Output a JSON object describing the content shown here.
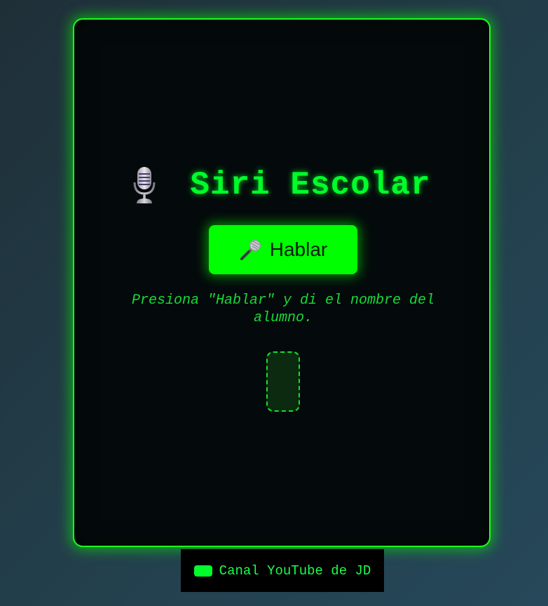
{
  "app": {
    "title": "Siri Escolar"
  },
  "main": {
    "speak_button_label": "Hablar",
    "instructions": "Presiona \"Hablar\" y di el nombre del alumno.",
    "result_text": ""
  },
  "footer": {
    "link_label": "Canal YouTube de JD"
  },
  "icons": {
    "title_icon": "studio-microphone-icon",
    "button_icon": "microphone-icon",
    "footer_icon": "youtube-icon"
  },
  "colors": {
    "accent": "#00ff00",
    "card_background": "#040a0b",
    "page_background": "#23404d",
    "result_box_fill": "#0b2a10"
  }
}
